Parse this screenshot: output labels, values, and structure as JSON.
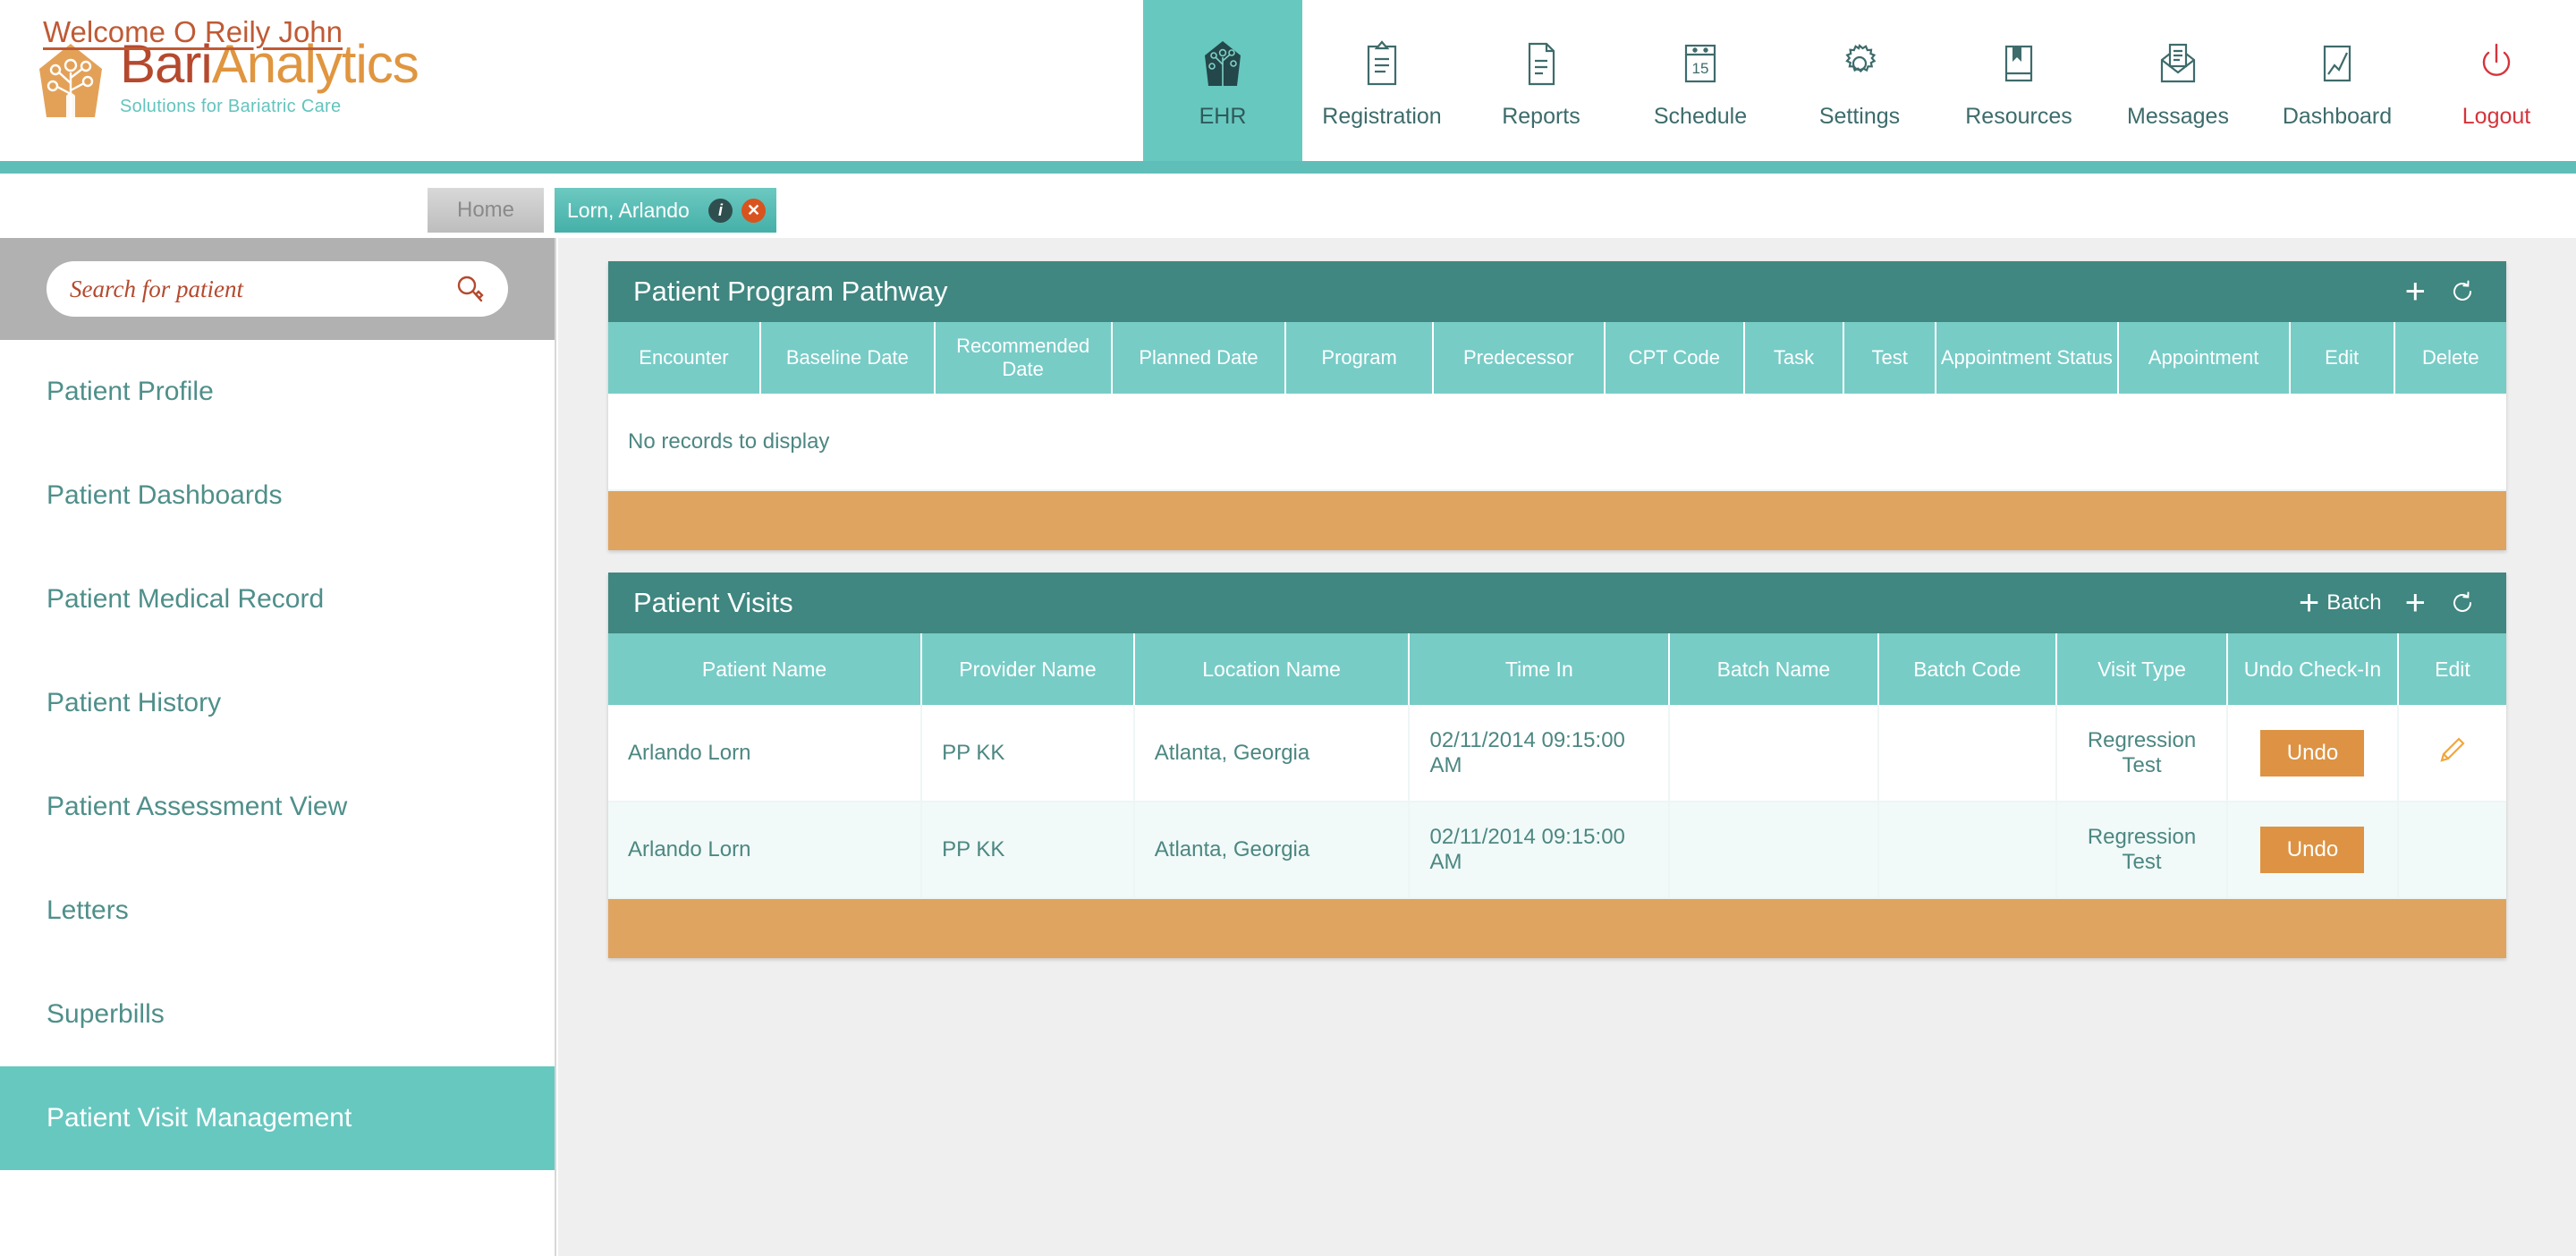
{
  "brand": {
    "name_part1": "Bari",
    "name_part2": "Analytics",
    "tagline": "Solutions for Bariatric Care",
    "accent_orange": "#e0953f",
    "accent_red": "#b5492e",
    "accent_teal": "#63c4bd"
  },
  "nav": {
    "items": [
      {
        "label": "EHR",
        "icon": "leaf-tree-icon",
        "active": true
      },
      {
        "label": "Registration",
        "icon": "clipboard-icon",
        "active": false
      },
      {
        "label": "Reports",
        "icon": "document-icon",
        "active": false
      },
      {
        "label": "Schedule",
        "icon": "calendar-15-icon",
        "active": false
      },
      {
        "label": "Settings",
        "icon": "gear-icon",
        "active": false
      },
      {
        "label": "Resources",
        "icon": "book-icon",
        "active": false
      },
      {
        "label": "Messages",
        "icon": "envelope-icon",
        "active": false
      },
      {
        "label": "Dashboard",
        "icon": "chart-line-icon",
        "active": false
      },
      {
        "label": "Logout",
        "icon": "power-icon",
        "active": false
      }
    ]
  },
  "welcome": {
    "text": "Welcome O Reily John"
  },
  "tabs": {
    "home": "Home",
    "patient": "Lorn, Arlando",
    "info_badge": "i",
    "close_badge": "✕"
  },
  "sidebar": {
    "search": {
      "placeholder": "Search for patient",
      "value": "",
      "icon": "search-icon"
    },
    "items": [
      {
        "label": "Patient Profile",
        "active": false
      },
      {
        "label": "Patient Dashboards",
        "active": false
      },
      {
        "label": "Patient Medical Record",
        "active": false
      },
      {
        "label": "Patient History",
        "active": false
      },
      {
        "label": "Patient Assessment View",
        "active": false
      },
      {
        "label": "Letters",
        "active": false
      },
      {
        "label": "Superbills",
        "active": false
      },
      {
        "label": "Patient Visit Management",
        "active": true
      }
    ]
  },
  "pathway_panel": {
    "title": "Patient Program Pathway",
    "actions": [
      {
        "label": "",
        "icon": "plus-icon"
      },
      {
        "label": "",
        "icon": "refresh-icon"
      }
    ],
    "columns": [
      "Encounter",
      "Baseline Date",
      "Recommended Date",
      "Planned Date",
      "Program",
      "Predecessor",
      "CPT Code",
      "Task",
      "Test",
      "Appointment Status",
      "Appointment",
      "Edit",
      "Delete"
    ],
    "empty_message": "No records to display",
    "rows": []
  },
  "visits_panel": {
    "title": "Patient Visits",
    "batch_label": "Batch",
    "actions": [
      {
        "label": "Batch",
        "icon": "plus-icon"
      },
      {
        "label": "",
        "icon": "plus-icon"
      },
      {
        "label": "",
        "icon": "refresh-icon"
      }
    ],
    "columns": [
      "Patient Name",
      "Provider Name",
      "Location Name",
      "Time In",
      "Batch Name",
      "Batch Code",
      "Visit Type",
      "Undo Check-In",
      "Edit"
    ],
    "rows": [
      {
        "patient_name": "Arlando Lorn",
        "provider_name": "PP KK",
        "location_name": "Atlanta, Georgia",
        "time_in": "02/11/2014 09:15:00 AM",
        "batch_name": "",
        "batch_code": "",
        "visit_type": "Regression Test",
        "undo_label": "Undo",
        "has_edit": true
      },
      {
        "patient_name": "Arlando Lorn",
        "provider_name": "PP KK",
        "location_name": "Atlanta, Georgia",
        "time_in": "02/11/2014 09:15:00 AM",
        "batch_name": "",
        "batch_code": "",
        "visit_type": "Regression Test",
        "undo_label": "Undo",
        "has_edit": false
      }
    ]
  },
  "colors": {
    "panel_header": "#3f8780",
    "table_header": "#77ccc6",
    "panel_footer": "#dfa45f",
    "undo_button": "#dd9343",
    "sidebar_active": "#67c8c0",
    "empty_text": "#d9434f"
  }
}
